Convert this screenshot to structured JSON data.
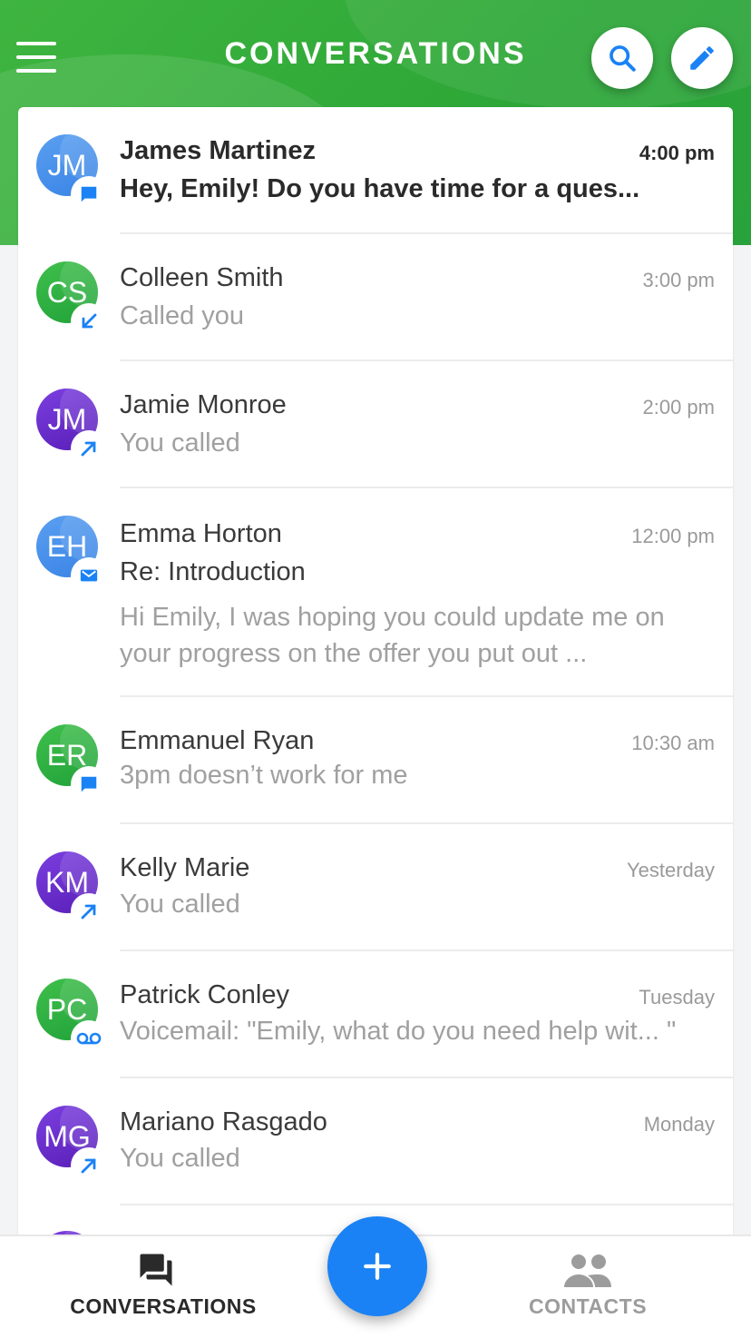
{
  "header": {
    "title": "CONVERSATIONS"
  },
  "colors": {
    "brand_green": "#2fa838",
    "accent_blue": "#1a82f5"
  },
  "conversations": [
    {
      "initials": "JM",
      "name": "James Martinez",
      "time": "4:00 pm",
      "preview": "Hey, Emily! Do you have time for a ques...",
      "type_icon": "message-icon",
      "unread": true
    },
    {
      "initials": "CS",
      "name": "Colleen Smith",
      "time": "3:00 pm",
      "preview": "Called you",
      "type_icon": "incoming-call-icon"
    },
    {
      "initials": "JM",
      "name": "Jamie Monroe",
      "time": "2:00 pm",
      "preview": "You called",
      "type_icon": "outgoing-call-icon"
    },
    {
      "initials": "EH",
      "name": "Emma Horton",
      "time": "12:00 pm",
      "subject": "Re: Introduction",
      "preview_line1": "Hi Emily, I was hoping you could update me on",
      "preview_line2": "your progress on the offer you put out ...",
      "type_icon": "email-icon"
    },
    {
      "initials": "ER",
      "name": "Emmanuel Ryan",
      "time": "10:30 am",
      "preview": "3pm doesn’t work for me",
      "type_icon": "message-icon"
    },
    {
      "initials": "KM",
      "name": "Kelly Marie",
      "time": "Yesterday",
      "preview": "You called",
      "type_icon": "outgoing-call-icon"
    },
    {
      "initials": "PC",
      "name": "Patrick Conley",
      "time": "Tuesday",
      "preview": "Voicemail: \"Emily, what do you need help wit... \"",
      "type_icon": "voicemail-icon"
    },
    {
      "initials": "MG",
      "name": "Mariano Rasgado",
      "time": "Monday",
      "preview": "You called",
      "type_icon": "outgoing-call-icon"
    }
  ],
  "bottom_nav": {
    "conversations_label": "CONVERSATIONS",
    "contacts_label": "CONTACTS"
  }
}
